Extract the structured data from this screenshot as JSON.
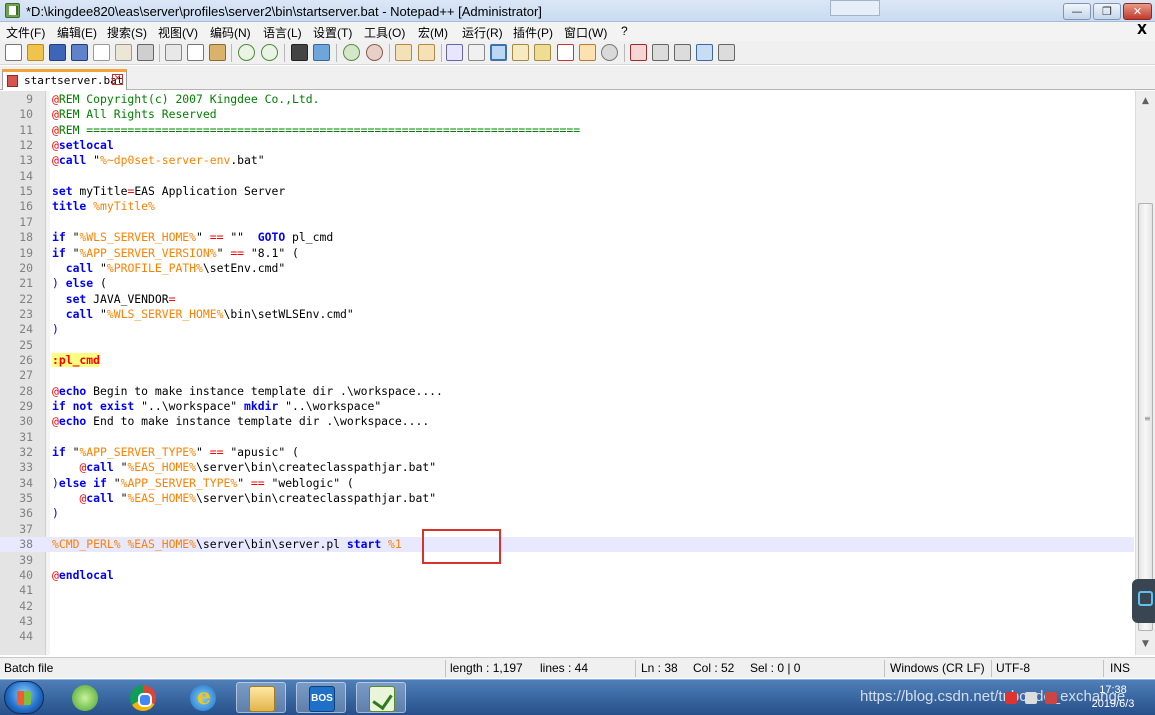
{
  "window": {
    "title": "*D:\\kingdee820\\eas\\server\\profiles\\server2\\bin\\startserver.bat - Notepad++ [Administrator]",
    "controls": {
      "minimize": "—",
      "maximize": "❐",
      "close": "✕"
    }
  },
  "menu": {
    "items": [
      "文件(F)",
      "编辑(E)",
      "搜索(S)",
      "视图(V)",
      "编码(N)",
      "语言(L)",
      "设置(T)",
      "工具(O)",
      "宏(M)",
      "运行(R)",
      "插件(P)",
      "窗口(W)",
      "?"
    ],
    "close_label": "X"
  },
  "toolbar": {
    "icons": [
      "new-file-icon",
      "open-file-icon",
      "save-icon",
      "save-all-icon",
      "close-icon",
      "close-all-icon",
      "print-icon",
      "cut-icon",
      "copy-icon",
      "paste-icon",
      "undo-icon",
      "redo-icon",
      "find-icon",
      "replace-icon",
      "zoom-in-icon",
      "zoom-out-icon",
      "sync-vertical-icon",
      "sync-horizontal-icon",
      "word-wrap-icon",
      "show-all-chars-icon",
      "indent-guide-icon",
      "language-icon",
      "user-defined-language-icon",
      "document-map-icon",
      "folder-as-workspace-icon",
      "monitoring-icon",
      "record-macro-icon",
      "stop-recording-icon",
      "playback-macro-icon",
      "run-macro-multiple-icon",
      "save-macro-icon"
    ]
  },
  "tab": {
    "label": "startserver.bat",
    "close": "✕"
  },
  "editor": {
    "current_line": "38",
    "lines": [
      {
        "n": "9",
        "tokens": [
          [
            "at",
            "@"
          ],
          [
            "rem",
            "REM Copyright(c) 2007 Kingdee Co.,Ltd."
          ]
        ]
      },
      {
        "n": "10",
        "tokens": [
          [
            "at",
            "@"
          ],
          [
            "rem",
            "REM All Rights Reserved"
          ]
        ]
      },
      {
        "n": "11",
        "tokens": [
          [
            "at",
            "@"
          ],
          [
            "rem",
            "REM ========================================================================"
          ]
        ]
      },
      {
        "n": "12",
        "tokens": [
          [
            "at",
            "@"
          ],
          [
            "kw",
            "setlocal"
          ]
        ]
      },
      {
        "n": "13",
        "tokens": [
          [
            "at",
            "@"
          ],
          [
            "kw",
            "call"
          ],
          [
            "txt",
            " \""
          ],
          [
            "var",
            "%~dp0set-server-env"
          ],
          [
            "txt",
            ".bat\""
          ]
        ]
      },
      {
        "n": "14",
        "tokens": []
      },
      {
        "n": "15",
        "tokens": [
          [
            "kw",
            "set"
          ],
          [
            "txt",
            " myTitle"
          ],
          [
            "op",
            "="
          ],
          [
            "txt",
            "EAS Application Server"
          ]
        ]
      },
      {
        "n": "16",
        "tokens": [
          [
            "kw",
            "title"
          ],
          [
            "txt",
            " "
          ],
          [
            "var",
            "%myTitle%"
          ]
        ]
      },
      {
        "n": "17",
        "tokens": []
      },
      {
        "n": "18",
        "tokens": [
          [
            "kw",
            "if"
          ],
          [
            "txt",
            " \""
          ],
          [
            "var",
            "%WLS_SERVER_HOME%"
          ],
          [
            "txt",
            "\" "
          ],
          [
            "op",
            "=="
          ],
          [
            "txt",
            " \"\"  "
          ],
          [
            "kw",
            "GOTO"
          ],
          [
            "txt",
            " pl_cmd"
          ]
        ]
      },
      {
        "n": "19",
        "tokens": [
          [
            "kw",
            "if"
          ],
          [
            "txt",
            " \""
          ],
          [
            "var",
            "%APP_SERVER_VERSION%"
          ],
          [
            "txt",
            "\" "
          ],
          [
            "op",
            "=="
          ],
          [
            "txt",
            " \"8.1\" ("
          ]
        ]
      },
      {
        "n": "20",
        "tokens": [
          [
            "txt",
            "  "
          ],
          [
            "kw",
            "call"
          ],
          [
            "txt",
            " \""
          ],
          [
            "var",
            "%PROFILE_PATH%"
          ],
          [
            "txt",
            "\\setEnv.cmd\""
          ]
        ]
      },
      {
        "n": "21",
        "tokens": [
          [
            "paren",
            ")"
          ],
          [
            "txt",
            " "
          ],
          [
            "kw",
            "else"
          ],
          [
            "txt",
            " ("
          ]
        ]
      },
      {
        "n": "22",
        "tokens": [
          [
            "txt",
            "  "
          ],
          [
            "kw",
            "set"
          ],
          [
            "txt",
            " JAVA_VENDOR"
          ],
          [
            "op",
            "="
          ]
        ]
      },
      {
        "n": "23",
        "tokens": [
          [
            "txt",
            "  "
          ],
          [
            "kw",
            "call"
          ],
          [
            "txt",
            " \""
          ],
          [
            "var",
            "%WLS_SERVER_HOME%"
          ],
          [
            "txt",
            "\\bin\\setWLSEnv.cmd\""
          ]
        ]
      },
      {
        "n": "24",
        "tokens": [
          [
            "paren",
            ")"
          ]
        ]
      },
      {
        "n": "25",
        "tokens": []
      },
      {
        "n": "26",
        "tokens": [
          [
            "label",
            ":pl_cmd"
          ]
        ]
      },
      {
        "n": "27",
        "tokens": []
      },
      {
        "n": "28",
        "tokens": [
          [
            "at",
            "@"
          ],
          [
            "kw",
            "echo"
          ],
          [
            "txt",
            " Begin to make instance template dir .\\workspace...."
          ]
        ]
      },
      {
        "n": "29",
        "tokens": [
          [
            "kw",
            "if not exist"
          ],
          [
            "txt",
            " \"..\\workspace\" "
          ],
          [
            "kw",
            "mkdir"
          ],
          [
            "txt",
            " \"..\\workspace\""
          ]
        ]
      },
      {
        "n": "30",
        "tokens": [
          [
            "at",
            "@"
          ],
          [
            "kw",
            "echo"
          ],
          [
            "txt",
            " End to make instance template dir .\\workspace...."
          ]
        ]
      },
      {
        "n": "31",
        "tokens": []
      },
      {
        "n": "32",
        "tokens": [
          [
            "kw",
            "if"
          ],
          [
            "txt",
            " \""
          ],
          [
            "var",
            "%APP_SERVER_TYPE%"
          ],
          [
            "txt",
            "\" "
          ],
          [
            "op",
            "=="
          ],
          [
            "txt",
            " \"apusic\" ("
          ]
        ]
      },
      {
        "n": "33",
        "tokens": [
          [
            "txt",
            "    "
          ],
          [
            "at",
            "@"
          ],
          [
            "kw",
            "call"
          ],
          [
            "txt",
            " \""
          ],
          [
            "var",
            "%EAS_HOME%"
          ],
          [
            "txt",
            "\\server\\bin\\createclasspathjar.bat\""
          ]
        ]
      },
      {
        "n": "34",
        "tokens": [
          [
            "paren",
            ")"
          ],
          [
            "kw",
            "else if"
          ],
          [
            "txt",
            " \""
          ],
          [
            "var",
            "%APP_SERVER_TYPE%"
          ],
          [
            "txt",
            "\" "
          ],
          [
            "op",
            "=="
          ],
          [
            "txt",
            " \"weblogic\" ("
          ]
        ]
      },
      {
        "n": "35",
        "tokens": [
          [
            "txt",
            "    "
          ],
          [
            "at",
            "@"
          ],
          [
            "kw",
            "call"
          ],
          [
            "txt",
            " \""
          ],
          [
            "var",
            "%EAS_HOME%"
          ],
          [
            "txt",
            "\\server\\bin\\createclasspathjar.bat\""
          ]
        ]
      },
      {
        "n": "36",
        "tokens": [
          [
            "paren",
            ")"
          ]
        ]
      },
      {
        "n": "37",
        "tokens": []
      },
      {
        "n": "38",
        "tokens": [
          [
            "var",
            "%CMD_PERL%"
          ],
          [
            "txt",
            " "
          ],
          [
            "var",
            "%EAS_HOME%"
          ],
          [
            "txt",
            "\\server\\bin\\server.pl "
          ],
          [
            "kw",
            "start"
          ],
          [
            "txt",
            " "
          ],
          [
            "var",
            "%1"
          ]
        ]
      },
      {
        "n": "39",
        "tokens": []
      },
      {
        "n": "40",
        "tokens": [
          [
            "at",
            "@"
          ],
          [
            "kw",
            "endlocal"
          ]
        ]
      },
      {
        "n": "41",
        "tokens": []
      },
      {
        "n": "42",
        "tokens": []
      },
      {
        "n": "43",
        "tokens": []
      },
      {
        "n": "44",
        "tokens": []
      }
    ]
  },
  "status": {
    "type": "Batch file",
    "length": "length : 1,197",
    "lines": "lines : 44",
    "ln": "Ln : 38",
    "col": "Col : 52",
    "sel": "Sel : 0 | 0",
    "eol": "Windows (CR LF)",
    "encoding": "UTF-8",
    "mode": "INS"
  },
  "taskbar": {
    "apps": [
      "refresh-app-icon",
      "chrome-icon",
      "internet-explorer-icon",
      "file-explorer-icon",
      "bos-app-icon",
      "notepadpp-icon"
    ],
    "bos_label": "BOS",
    "clock_time": "17:38",
    "clock_date": "2019/6/3",
    "watermark": "https://blog.csdn.net/tnbcode_exchange"
  }
}
